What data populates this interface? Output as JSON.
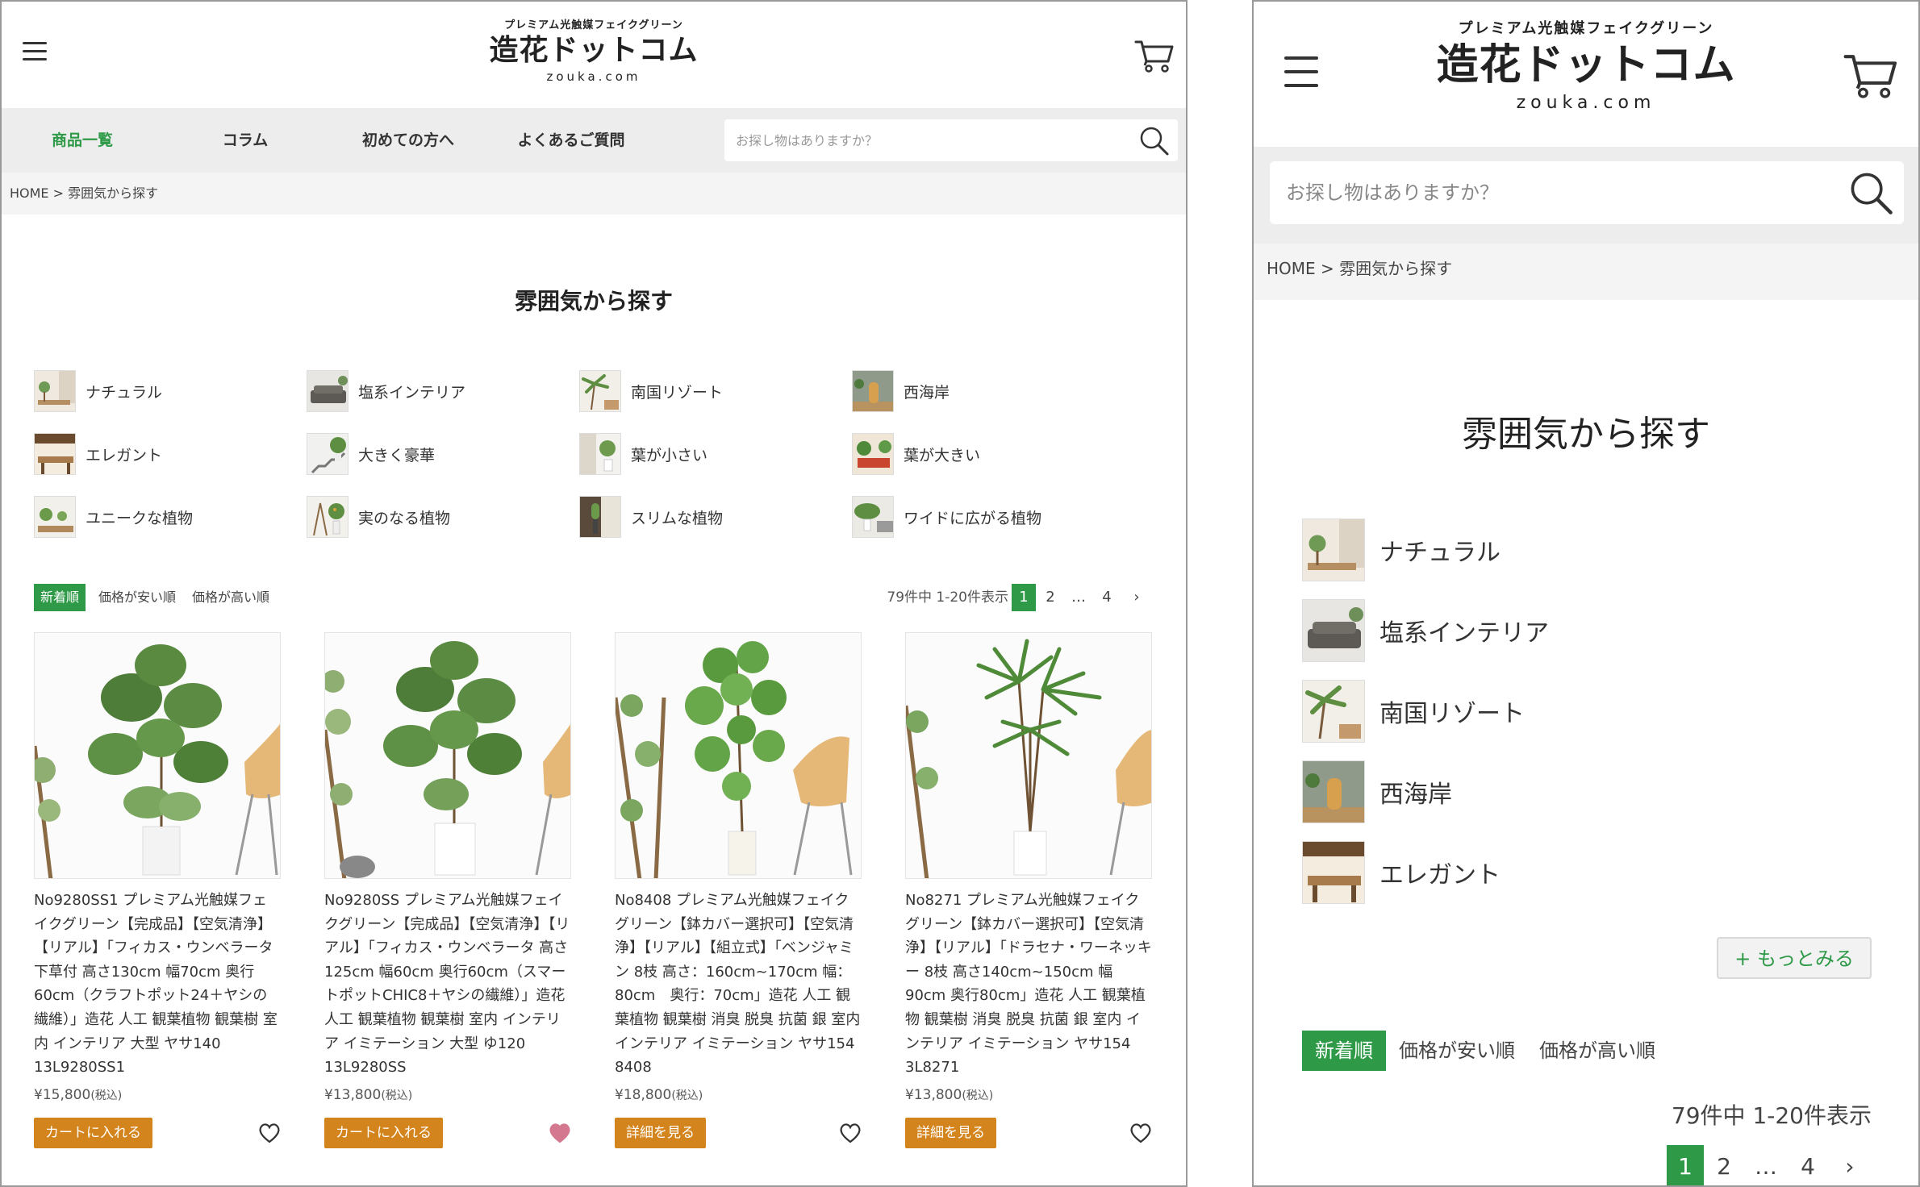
{
  "site": {
    "tagline": "プレミアム光触媒フェイクグリーン",
    "name": "造花ドットコム",
    "domain": "zouka.com"
  },
  "nav": {
    "items": [
      {
        "label": "商品一覧",
        "active": true
      },
      {
        "label": "コラム",
        "active": false
      },
      {
        "label": "初めての方へ",
        "active": false
      },
      {
        "label": "よくあるご質問",
        "active": false
      }
    ]
  },
  "search": {
    "placeholder": "お探し物はありますか？"
  },
  "breadcrumb": {
    "home": "HOME",
    "separator": " > ",
    "current": "雰囲気から探す"
  },
  "page_title": "雰囲気から探す",
  "categories": [
    {
      "label": "ナチュラル"
    },
    {
      "label": "塩系インテリア"
    },
    {
      "label": "南国リゾート"
    },
    {
      "label": "西海岸"
    },
    {
      "label": "エレガント"
    },
    {
      "label": "大きく豪華"
    },
    {
      "label": "葉が小さい"
    },
    {
      "label": "葉が大きい"
    },
    {
      "label": "ユニークな植物"
    },
    {
      "label": "実のなる植物"
    },
    {
      "label": "スリムな植物"
    },
    {
      "label": "ワイドに広がる植物"
    }
  ],
  "sort": {
    "options": [
      {
        "label": "新着順",
        "active": true
      },
      {
        "label": "価格が安い順",
        "active": false
      },
      {
        "label": "価格が高い順",
        "active": false
      }
    ]
  },
  "result_count": "79件中 1-20件表示",
  "pagination": {
    "pages": [
      "1",
      "2",
      "…",
      "4"
    ],
    "current": "1",
    "next": "›"
  },
  "products": [
    {
      "title": "No9280SS1 プレミアム光触媒フェイクグリーン【完成品】【空気清浄】【リアル】「フィカス・ウンベラータ 下草付 高さ130cm 幅70cm 奥行60cm（クラフトポット24＋ヤシの繊維）」造花 人工 観葉植物 観葉樹 室内 インテリア 大型 ヤサ140 13L9280SS1",
      "price": "¥15,800",
      "tax": "(税込)",
      "button": "カートに入れる",
      "favorited": false
    },
    {
      "title": "No9280SS プレミアム光触媒フェイクグリーン【完成品】【空気清浄】【リアル】「フィカス・ウンベラータ 高さ125cm 幅60cm 奥行60cm（スマートポットCHIC8＋ヤシの繊維）」造花 人工 観葉植物 観葉樹 室内 インテリア イミテーション 大型 ゆ120 13L9280SS",
      "price": "¥13,800",
      "tax": "(税込)",
      "button": "カートに入れる",
      "favorited": true
    },
    {
      "title": "No8408 プレミアム光触媒フェイクグリーン【鉢カバー選択可】【空気清浄】【リアル】【組立式】「ベンジャミン 8枝 高さ：160cm~170cm 幅：80cm　奥行：70cm」造花 人工 観葉植物 観葉樹 消臭 脱臭 抗菌 銀 室内 インテリア イミテーション ヤサ154 8408",
      "price": "¥18,800",
      "tax": "(税込)",
      "button": "詳細を見る",
      "favorited": false
    },
    {
      "title": "No8271 プレミアム光触媒フェイクグリーン【鉢カバー選択可】【空気清浄】【リアル】「ドラセナ・ワーネッキー 8枝 高さ140cm~150cm 幅90cm 奥行80cm」造花 人工 観葉植物 観葉樹 消臭 脱臭 抗菌 銀 室内 インテリア イミテーション ヤサ154 3L8271",
      "price": "¥13,800",
      "tax": "(税込)",
      "button": "詳細を見る",
      "favorited": false
    }
  ],
  "mobile": {
    "categories": [
      {
        "label": "ナチュラル"
      },
      {
        "label": "塩系インテリア"
      },
      {
        "label": "南国リゾート"
      },
      {
        "label": "西海岸"
      },
      {
        "label": "エレガント"
      }
    ],
    "more_button": "+ もっとみる"
  },
  "colors": {
    "accent": "#2e9a48",
    "button_orange": "#d4841c",
    "heart_active": "#d4788f",
    "nav_bg": "#ededed"
  }
}
